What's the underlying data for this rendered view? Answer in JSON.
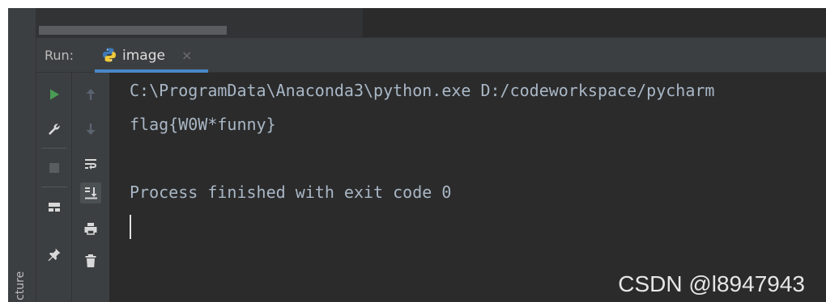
{
  "structure_label": "cture",
  "run_panel": {
    "label": "Run:",
    "tab": {
      "title": "image",
      "close_glyph": "×",
      "icon": "python-icon"
    }
  },
  "toolbar_left": {
    "items": [
      {
        "name": "run-icon",
        "glyph": "play",
        "color": "#499c54"
      },
      {
        "name": "wrench-icon",
        "glyph": "wrench"
      },
      {
        "name": "stop-icon",
        "glyph": "stop",
        "color": "#5a5d5f"
      },
      {
        "name": "layout-icon",
        "glyph": "layout"
      },
      {
        "name": "pin-icon",
        "glyph": "pin"
      }
    ]
  },
  "toolbar_right": {
    "items": [
      {
        "name": "up-arrow-icon",
        "glyph": "arrow-up",
        "color": "#5a6370"
      },
      {
        "name": "down-arrow-icon",
        "glyph": "arrow-down",
        "color": "#5a6370"
      },
      {
        "name": "soft-wrap-icon",
        "glyph": "wrap"
      },
      {
        "name": "scroll-to-end-icon",
        "glyph": "scroll-end"
      },
      {
        "name": "print-icon",
        "glyph": "print"
      },
      {
        "name": "trash-icon",
        "glyph": "trash"
      }
    ]
  },
  "console": {
    "lines": [
      "C:\\ProgramData\\Anaconda3\\python.exe D:/codeworkspace/pycharm",
      "flag{W0W*funny}",
      "",
      "Process finished with exit code 0"
    ]
  },
  "watermark": "CSDN @l8947943",
  "colors": {
    "console_bg": "#2b2b2b",
    "panel_bg": "#3c3f41",
    "console_text": "#a9b7c6",
    "tab_underline": "#4a88c7",
    "run_green": "#499c54"
  }
}
